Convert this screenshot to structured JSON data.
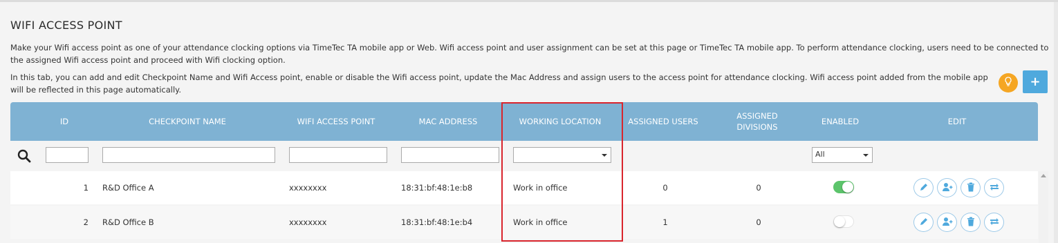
{
  "page": {
    "title": "WIFI ACCESS POINT",
    "description1": "Make your Wifi access point as one of your attendance clocking options via TimeTec TA mobile app or Web. Wifi access point and user assignment can be set at this page or TimeTec TA mobile app. To perform attendance clocking, users need to be connected to the assigned Wifi access point and proceed with Wifi clocking option.",
    "description2": "In this tab, you can add and edit Checkpoint Name and Wifi Access point, enable or disable the Wifi access point, update the Mac Address and assign users to the access point for attendance clocking. Wifi access point added from the mobile app will be reflected in this page automatically.",
    "add_button": "+"
  },
  "table": {
    "headers": {
      "id": "ID",
      "checkpoint_name": "CHECKPOINT NAME",
      "wifi_access_point": "WIFI ACCESS POINT",
      "mac_address": "MAC ADDRESS",
      "working_location": "WORKING LOCATION",
      "assigned_users": "ASSIGNED USERS",
      "assigned_divisions": "ASSIGNED DIVISIONS",
      "enabled": "ENABLED",
      "edit": "EDIT"
    },
    "filters": {
      "working_location_selected": "",
      "enabled_selected": "All"
    },
    "rows": [
      {
        "id": "1",
        "checkpoint_name": "R&D Office A",
        "wifi_access_point": "xxxxxxxx",
        "mac_address": "18:31:bf:48:1e:b8",
        "working_location": "Work in office",
        "assigned_users": "0",
        "assigned_divisions": "0",
        "enabled": true
      },
      {
        "id": "2",
        "checkpoint_name": "R&D Office B",
        "wifi_access_point": "xxxxxxxx",
        "mac_address": "18:31:bf:48:1e:b4",
        "working_location": "Work in office",
        "assigned_users": "1",
        "assigned_divisions": "0",
        "enabled": false
      }
    ]
  },
  "colors": {
    "header_bg": "#7fb2d3",
    "accent_blue": "#4fa9dd",
    "toggle_on": "#5cc46b",
    "tip_orange": "#f5a623",
    "highlight_red": "#d9242c"
  },
  "icons": [
    "search-icon",
    "lightbulb-icon",
    "plus-icon",
    "pencil-icon",
    "add-user-icon",
    "trash-icon",
    "sync-icon",
    "caret-down-icon",
    "scroll-up-icon"
  ]
}
